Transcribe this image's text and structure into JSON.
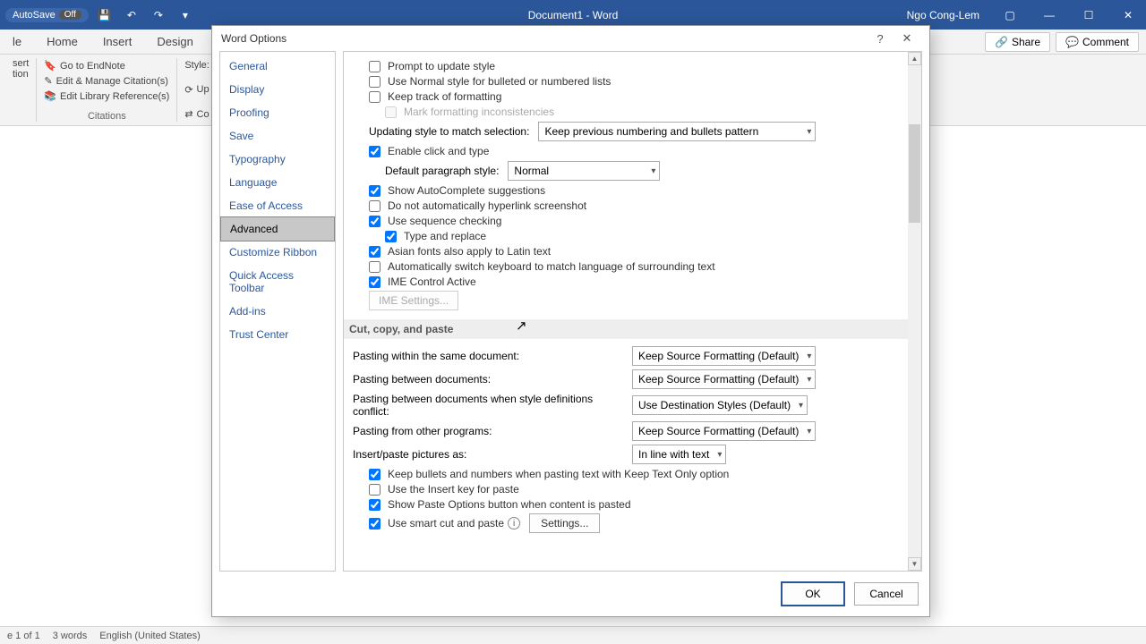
{
  "titlebar": {
    "autosave_label": "AutoSave",
    "autosave_state": "Off",
    "doc_title": "Document1 - Word",
    "user": "Ngo Cong-Lem"
  },
  "ribbon_tabs": {
    "file": "le",
    "home": "Home",
    "insert": "Insert",
    "design": "Design"
  },
  "ribbon_right": {
    "share": "Share",
    "comment": "Comment"
  },
  "ribbon": {
    "endnote": "Go to EndNote",
    "edit_citations": "Edit & Manage Citation(s)",
    "edit_library": "Edit Library Reference(s)",
    "group_citations": "Citations",
    "style_label": "Style:",
    "update_btn": "Up",
    "convert_btn": "Co",
    "insert_group": "sert\ntion"
  },
  "statusbar": {
    "page": "e 1 of 1",
    "words": "3 words",
    "lang": "English (United States)"
  },
  "dialog": {
    "title": "Word Options",
    "help": "?",
    "close": "✕",
    "sidebar": [
      "General",
      "Display",
      "Proofing",
      "Save",
      "Typography",
      "Language",
      "Ease of Access",
      "Advanced",
      "Customize Ribbon",
      "Quick Access Toolbar",
      "Add-ins",
      "Trust Center"
    ],
    "opts": {
      "prompt_update_style": "Prompt to update style",
      "use_normal_lists": "Use Normal style for bulleted or numbered lists",
      "keep_track_formatting": "Keep track of formatting",
      "mark_inconsistencies": "Mark formatting inconsistencies",
      "updating_style_label": "Updating style to match selection:",
      "updating_style_value": "Keep previous numbering and bullets pattern",
      "enable_click_type": "Enable click and type",
      "default_para_style_label": "Default paragraph style:",
      "default_para_style_value": "Normal",
      "show_autocomplete": "Show AutoComplete suggestions",
      "no_auto_hyperlink": "Do not automatically hyperlink screenshot",
      "use_sequence": "Use sequence checking",
      "type_replace": "Type and replace",
      "asian_fonts_latin": "Asian fonts also apply to Latin text",
      "auto_switch_keyboard": "Automatically switch keyboard to match language of surrounding text",
      "ime_control_active": "IME Control Active",
      "ime_settings_btn": "IME Settings...",
      "section_cut": "Cut, copy, and paste",
      "paste_within_label": "Pasting within the same document:",
      "paste_within_value": "Keep Source Formatting (Default)",
      "paste_between_label": "Pasting between documents:",
      "paste_between_value": "Keep Source Formatting (Default)",
      "paste_conflict_label": "Pasting between documents when style definitions conflict:",
      "paste_conflict_value": "Use Destination Styles (Default)",
      "paste_other_label": "Pasting from other programs:",
      "paste_other_value": "Keep Source Formatting (Default)",
      "insert_pictures_label": "Insert/paste pictures as:",
      "insert_pictures_value": "In line with text",
      "keep_bullets_numbers": "Keep bullets and numbers when pasting text with Keep Text Only option",
      "use_insert_key": "Use the Insert key for paste",
      "show_paste_options": "Show Paste Options button when content is pasted",
      "smart_cut_paste": "Use smart cut and paste",
      "settings_btn": "Settings..."
    },
    "footer": {
      "ok": "OK",
      "cancel": "Cancel"
    }
  }
}
